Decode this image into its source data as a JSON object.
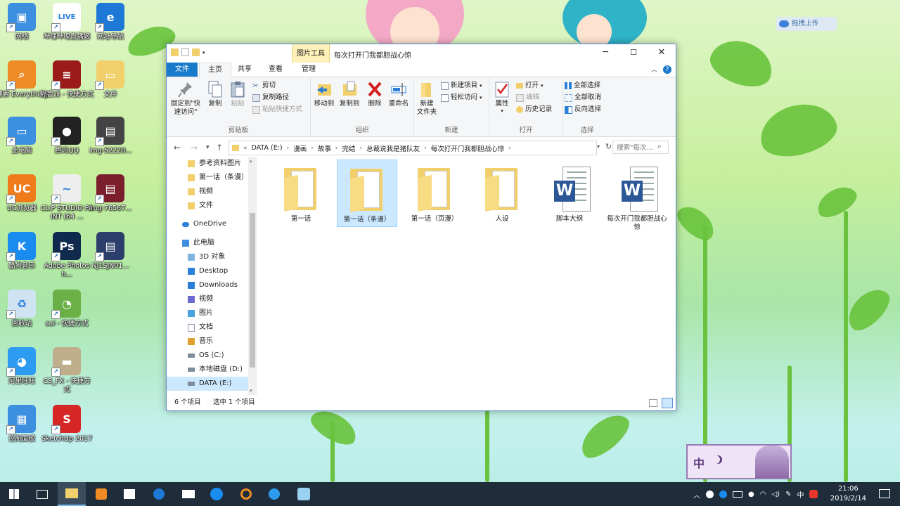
{
  "desktop_icons": [
    {
      "label": "网络",
      "color": "#3d8fe0",
      "glyph": "▣"
    },
    {
      "label": "哔哩哔哩直播姬",
      "color": "#ffffff",
      "glyph": "LIVE"
    },
    {
      "label": "网址导航",
      "color": "#1e78d6",
      "glyph": "e"
    },
    {
      "label": "搜索 Everything",
      "color": "#f08a24",
      "glyph": "⌕"
    },
    {
      "label": "野兽派 - 快捷方式",
      "color": "#9b1b1b",
      "glyph": "≡"
    },
    {
      "label": "文件",
      "color": "#f1cf6b",
      "glyph": "▭"
    },
    {
      "label": "此电脑",
      "color": "#3d8fe0",
      "glyph": "▭"
    },
    {
      "label": "腾讯QQ",
      "color": "#222222",
      "glyph": "●"
    },
    {
      "label": "img-52220...",
      "color": "#444444",
      "glyph": "▤"
    },
    {
      "label": "UC浏览器",
      "color": "#f07b1a",
      "glyph": "UC"
    },
    {
      "label": "CLIP STUDIO PAINT (64 ...",
      "color": "#eeeeee",
      "glyph": "~"
    },
    {
      "label": "img-76567...",
      "color": "#7a1f2b",
      "glyph": "▤"
    },
    {
      "label": "酷狗音乐",
      "color": "#1a8cf0",
      "glyph": "K"
    },
    {
      "label": "Adobe Photosh...",
      "color": "#0f2a4d",
      "glyph": "Ps"
    },
    {
      "label": "NJ1SJN01...",
      "color": "#2c3e6b",
      "glyph": "▤"
    },
    {
      "label": "回收站",
      "color": "#cfe3f2",
      "glyph": "♻"
    },
    {
      "label": "sai - 快捷方式",
      "color": "#6bb046",
      "glyph": "◔"
    },
    {
      "label": "阿里旺旺",
      "color": "#2d9cf0",
      "glyph": "◕"
    },
    {
      "label": "CS_FX - 快捷方式",
      "color": "#bfae8c",
      "glyph": "▬"
    },
    {
      "label": "控制面板",
      "color": "#3d8fe0",
      "glyph": "▦"
    },
    {
      "label": "SketchUp 2017",
      "color": "#d62626",
      "glyph": "S"
    }
  ],
  "upload_widget": {
    "label": "拖拽上传",
    "icon": "cloud-icon"
  },
  "window": {
    "context_tab": "图片工具",
    "title": "每次打开门我都胆战心惊",
    "controls": {
      "minimize": "─",
      "maximize": "☐",
      "close": "✕"
    },
    "tabs": {
      "file": "文件",
      "home": "主页",
      "share": "共享",
      "view": "查看",
      "manage": "管理"
    },
    "ribbon": {
      "clipboard": {
        "name": "剪贴板",
        "pin": "固定到\"快速访问\"",
        "copy": "复制",
        "paste": "粘贴",
        "cut": "剪切",
        "copy_path": "复制路径",
        "paste_shortcut": "粘贴快捷方式"
      },
      "organize": {
        "name": "组织",
        "move_to": "移动到",
        "copy_to": "复制到",
        "delete": "删除",
        "rename": "重命名"
      },
      "new": {
        "name": "新建",
        "new_folder": "新建\n文件夹",
        "new_item": "新建项目",
        "easy_access": "轻松访问"
      },
      "open": {
        "name": "打开",
        "properties": "属性",
        "open": "打开",
        "edit": "编辑",
        "history": "历史记录"
      },
      "select": {
        "name": "选择",
        "select_all": "全部选择",
        "select_none": "全部取消",
        "invert": "反向选择"
      }
    },
    "address": {
      "segments": [
        "DATA (E:)",
        "漫画",
        "故事",
        "完结",
        "总裁说我是猪队友",
        "每次打开门我都胆战心惊"
      ],
      "search_placeholder": "搜索\"每次..."
    },
    "nav": [
      {
        "label": "参考资料图片",
        "indent": 1,
        "icon": "folder",
        "selected": false
      },
      {
        "label": "第一话（条漫）",
        "indent": 1,
        "icon": "folder",
        "selected": false
      },
      {
        "label": "视频",
        "indent": 1,
        "icon": "folder",
        "selected": false
      },
      {
        "label": "文件",
        "indent": 1,
        "icon": "folder",
        "selected": false
      },
      {
        "label": "OneDrive",
        "indent": 0,
        "icon": "cloud",
        "selected": false
      },
      {
        "label": "此电脑",
        "indent": 0,
        "icon": "pc",
        "selected": false
      },
      {
        "label": "3D 对象",
        "indent": 1,
        "icon": "cube",
        "selected": false
      },
      {
        "label": "Desktop",
        "indent": 1,
        "icon": "desktop",
        "selected": false
      },
      {
        "label": "Downloads",
        "indent": 1,
        "icon": "download",
        "selected": false
      },
      {
        "label": "视频",
        "indent": 1,
        "icon": "video",
        "selected": false
      },
      {
        "label": "图片",
        "indent": 1,
        "icon": "picture",
        "selected": false
      },
      {
        "label": "文档",
        "indent": 1,
        "icon": "document",
        "selected": false
      },
      {
        "label": "音乐",
        "indent": 1,
        "icon": "music",
        "selected": false
      },
      {
        "label": "OS (C:)",
        "indent": 1,
        "icon": "drive",
        "selected": false
      },
      {
        "label": "本地磁盘 (D:)",
        "indent": 1,
        "icon": "drive",
        "selected": false
      },
      {
        "label": "DATA (E:)",
        "indent": 1,
        "icon": "drive",
        "selected": true
      }
    ],
    "files": [
      {
        "name": "第一话",
        "type": "folder",
        "selected": false
      },
      {
        "name": "第一话（条漫）",
        "type": "folder",
        "selected": true
      },
      {
        "name": "第一话（页漫）",
        "type": "folder",
        "selected": false
      },
      {
        "name": "人设",
        "type": "folder",
        "selected": false
      },
      {
        "name": "脚本大纲",
        "type": "word",
        "selected": false
      },
      {
        "name": "每次开门我都胆战心惊",
        "type": "word",
        "selected": false
      }
    ],
    "status": {
      "count": "6 个项目",
      "selection": "选中 1 个项目"
    }
  },
  "ime_widget": {
    "label": "中"
  },
  "taskbar": {
    "apps": [
      "windows-logo-icon",
      "task-view-icon",
      "file-explorer-icon",
      "paint-icon",
      "store-icon",
      "edge-icon",
      "mail-icon",
      "kugou-icon",
      "everything-icon",
      "ie-icon",
      "bilibili-icon"
    ],
    "tray_ime": "中",
    "time": "21:06",
    "date": "2019/2/14"
  },
  "colors": {
    "accent": "#1979ca",
    "selection": "#cce8ff",
    "taskbar": "#1f2d3b"
  }
}
